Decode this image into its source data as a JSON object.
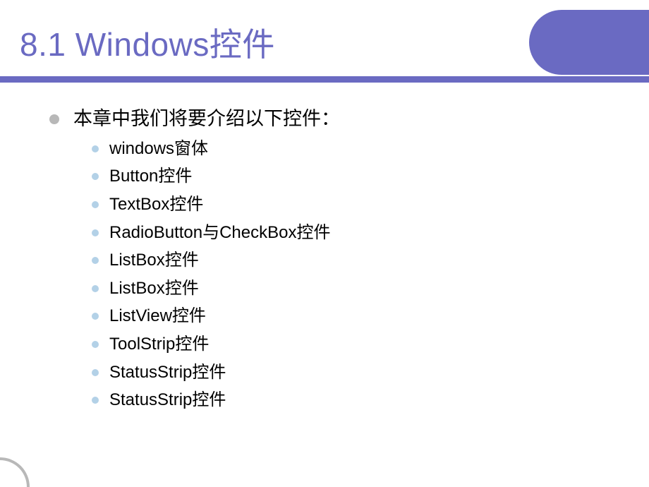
{
  "title": "8.1 Windows控件",
  "colors": {
    "accent": "#6a6ac2",
    "bullet_main": "#b8b8b8",
    "bullet_sub": "#b3d1e7"
  },
  "main_text": "本章中我们将要介绍以下控件：",
  "items": [
    "windows窗体",
    "Button控件",
    "TextBox控件",
    "RadioButton与CheckBox控件",
    "ListBox控件",
    "ListBox控件",
    "ListView控件",
    "ToolStrip控件",
    "StatusStrip控件",
    "StatusStrip控件"
  ]
}
